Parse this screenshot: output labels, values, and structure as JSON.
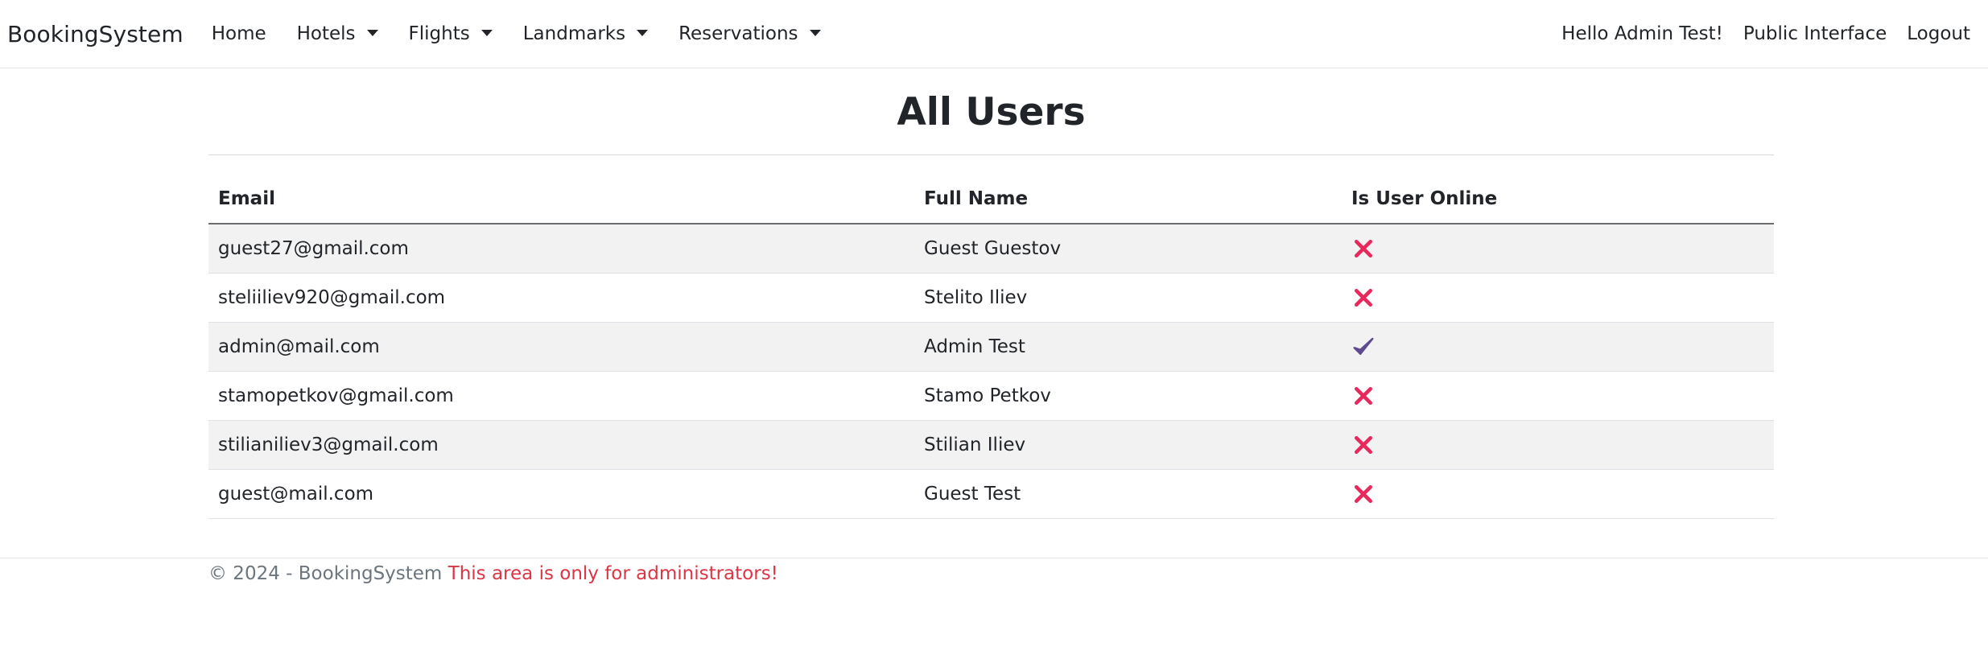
{
  "navbar": {
    "brand": "BookingSystem",
    "items": [
      {
        "label": "Home",
        "dropdown": false
      },
      {
        "label": "Hotels",
        "dropdown": true
      },
      {
        "label": "Flights",
        "dropdown": true
      },
      {
        "label": "Landmarks",
        "dropdown": true
      },
      {
        "label": "Reservations",
        "dropdown": true
      }
    ],
    "greeting": "Hello Admin Test!",
    "public_interface": "Public Interface",
    "logout": "Logout"
  },
  "page": {
    "title": "All Users"
  },
  "table": {
    "headers": [
      "Email",
      "Full Name",
      "Is User Online"
    ],
    "rows": [
      {
        "email": "guest27@gmail.com",
        "full_name": "Guest Guestov",
        "online": false
      },
      {
        "email": "steliiliev920@gmail.com",
        "full_name": "Stelito Iliev",
        "online": false
      },
      {
        "email": "admin@mail.com",
        "full_name": "Admin Test",
        "online": true
      },
      {
        "email": "stamopetkov@gmail.com",
        "full_name": "Stamo Petkov",
        "online": false
      },
      {
        "email": "stilianiliev3@gmail.com",
        "full_name": "Stilian Iliev",
        "online": false
      },
      {
        "email": "guest@mail.com",
        "full_name": "Guest Test",
        "online": false
      }
    ]
  },
  "icons": {
    "online": "check-icon",
    "offline": "cross-icon"
  },
  "colors": {
    "offline": "#e8275b",
    "online": "#5e4a8e",
    "warning": "#dc3545"
  },
  "footer": {
    "copyright": "© 2024 - BookingSystem",
    "admin_note": "This area is only for administrators!"
  }
}
